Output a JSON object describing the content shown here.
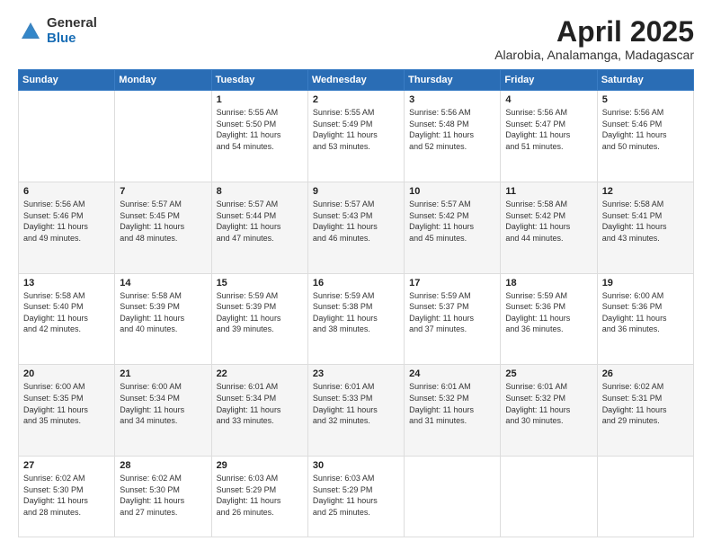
{
  "header": {
    "logo_general": "General",
    "logo_blue": "Blue",
    "month": "April 2025",
    "location": "Alarobia, Analamanga, Madagascar"
  },
  "days_of_week": [
    "Sunday",
    "Monday",
    "Tuesday",
    "Wednesday",
    "Thursday",
    "Friday",
    "Saturday"
  ],
  "weeks": [
    [
      {
        "day": "",
        "detail": ""
      },
      {
        "day": "",
        "detail": ""
      },
      {
        "day": "1",
        "detail": "Sunrise: 5:55 AM\nSunset: 5:50 PM\nDaylight: 11 hours\nand 54 minutes."
      },
      {
        "day": "2",
        "detail": "Sunrise: 5:55 AM\nSunset: 5:49 PM\nDaylight: 11 hours\nand 53 minutes."
      },
      {
        "day": "3",
        "detail": "Sunrise: 5:56 AM\nSunset: 5:48 PM\nDaylight: 11 hours\nand 52 minutes."
      },
      {
        "day": "4",
        "detail": "Sunrise: 5:56 AM\nSunset: 5:47 PM\nDaylight: 11 hours\nand 51 minutes."
      },
      {
        "day": "5",
        "detail": "Sunrise: 5:56 AM\nSunset: 5:46 PM\nDaylight: 11 hours\nand 50 minutes."
      }
    ],
    [
      {
        "day": "6",
        "detail": "Sunrise: 5:56 AM\nSunset: 5:46 PM\nDaylight: 11 hours\nand 49 minutes."
      },
      {
        "day": "7",
        "detail": "Sunrise: 5:57 AM\nSunset: 5:45 PM\nDaylight: 11 hours\nand 48 minutes."
      },
      {
        "day": "8",
        "detail": "Sunrise: 5:57 AM\nSunset: 5:44 PM\nDaylight: 11 hours\nand 47 minutes."
      },
      {
        "day": "9",
        "detail": "Sunrise: 5:57 AM\nSunset: 5:43 PM\nDaylight: 11 hours\nand 46 minutes."
      },
      {
        "day": "10",
        "detail": "Sunrise: 5:57 AM\nSunset: 5:42 PM\nDaylight: 11 hours\nand 45 minutes."
      },
      {
        "day": "11",
        "detail": "Sunrise: 5:58 AM\nSunset: 5:42 PM\nDaylight: 11 hours\nand 44 minutes."
      },
      {
        "day": "12",
        "detail": "Sunrise: 5:58 AM\nSunset: 5:41 PM\nDaylight: 11 hours\nand 43 minutes."
      }
    ],
    [
      {
        "day": "13",
        "detail": "Sunrise: 5:58 AM\nSunset: 5:40 PM\nDaylight: 11 hours\nand 42 minutes."
      },
      {
        "day": "14",
        "detail": "Sunrise: 5:58 AM\nSunset: 5:39 PM\nDaylight: 11 hours\nand 40 minutes."
      },
      {
        "day": "15",
        "detail": "Sunrise: 5:59 AM\nSunset: 5:39 PM\nDaylight: 11 hours\nand 39 minutes."
      },
      {
        "day": "16",
        "detail": "Sunrise: 5:59 AM\nSunset: 5:38 PM\nDaylight: 11 hours\nand 38 minutes."
      },
      {
        "day": "17",
        "detail": "Sunrise: 5:59 AM\nSunset: 5:37 PM\nDaylight: 11 hours\nand 37 minutes."
      },
      {
        "day": "18",
        "detail": "Sunrise: 5:59 AM\nSunset: 5:36 PM\nDaylight: 11 hours\nand 36 minutes."
      },
      {
        "day": "19",
        "detail": "Sunrise: 6:00 AM\nSunset: 5:36 PM\nDaylight: 11 hours\nand 36 minutes."
      }
    ],
    [
      {
        "day": "20",
        "detail": "Sunrise: 6:00 AM\nSunset: 5:35 PM\nDaylight: 11 hours\nand 35 minutes."
      },
      {
        "day": "21",
        "detail": "Sunrise: 6:00 AM\nSunset: 5:34 PM\nDaylight: 11 hours\nand 34 minutes."
      },
      {
        "day": "22",
        "detail": "Sunrise: 6:01 AM\nSunset: 5:34 PM\nDaylight: 11 hours\nand 33 minutes."
      },
      {
        "day": "23",
        "detail": "Sunrise: 6:01 AM\nSunset: 5:33 PM\nDaylight: 11 hours\nand 32 minutes."
      },
      {
        "day": "24",
        "detail": "Sunrise: 6:01 AM\nSunset: 5:32 PM\nDaylight: 11 hours\nand 31 minutes."
      },
      {
        "day": "25",
        "detail": "Sunrise: 6:01 AM\nSunset: 5:32 PM\nDaylight: 11 hours\nand 30 minutes."
      },
      {
        "day": "26",
        "detail": "Sunrise: 6:02 AM\nSunset: 5:31 PM\nDaylight: 11 hours\nand 29 minutes."
      }
    ],
    [
      {
        "day": "27",
        "detail": "Sunrise: 6:02 AM\nSunset: 5:30 PM\nDaylight: 11 hours\nand 28 minutes."
      },
      {
        "day": "28",
        "detail": "Sunrise: 6:02 AM\nSunset: 5:30 PM\nDaylight: 11 hours\nand 27 minutes."
      },
      {
        "day": "29",
        "detail": "Sunrise: 6:03 AM\nSunset: 5:29 PM\nDaylight: 11 hours\nand 26 minutes."
      },
      {
        "day": "30",
        "detail": "Sunrise: 6:03 AM\nSunset: 5:29 PM\nDaylight: 11 hours\nand 25 minutes."
      },
      {
        "day": "",
        "detail": ""
      },
      {
        "day": "",
        "detail": ""
      },
      {
        "day": "",
        "detail": ""
      }
    ]
  ]
}
